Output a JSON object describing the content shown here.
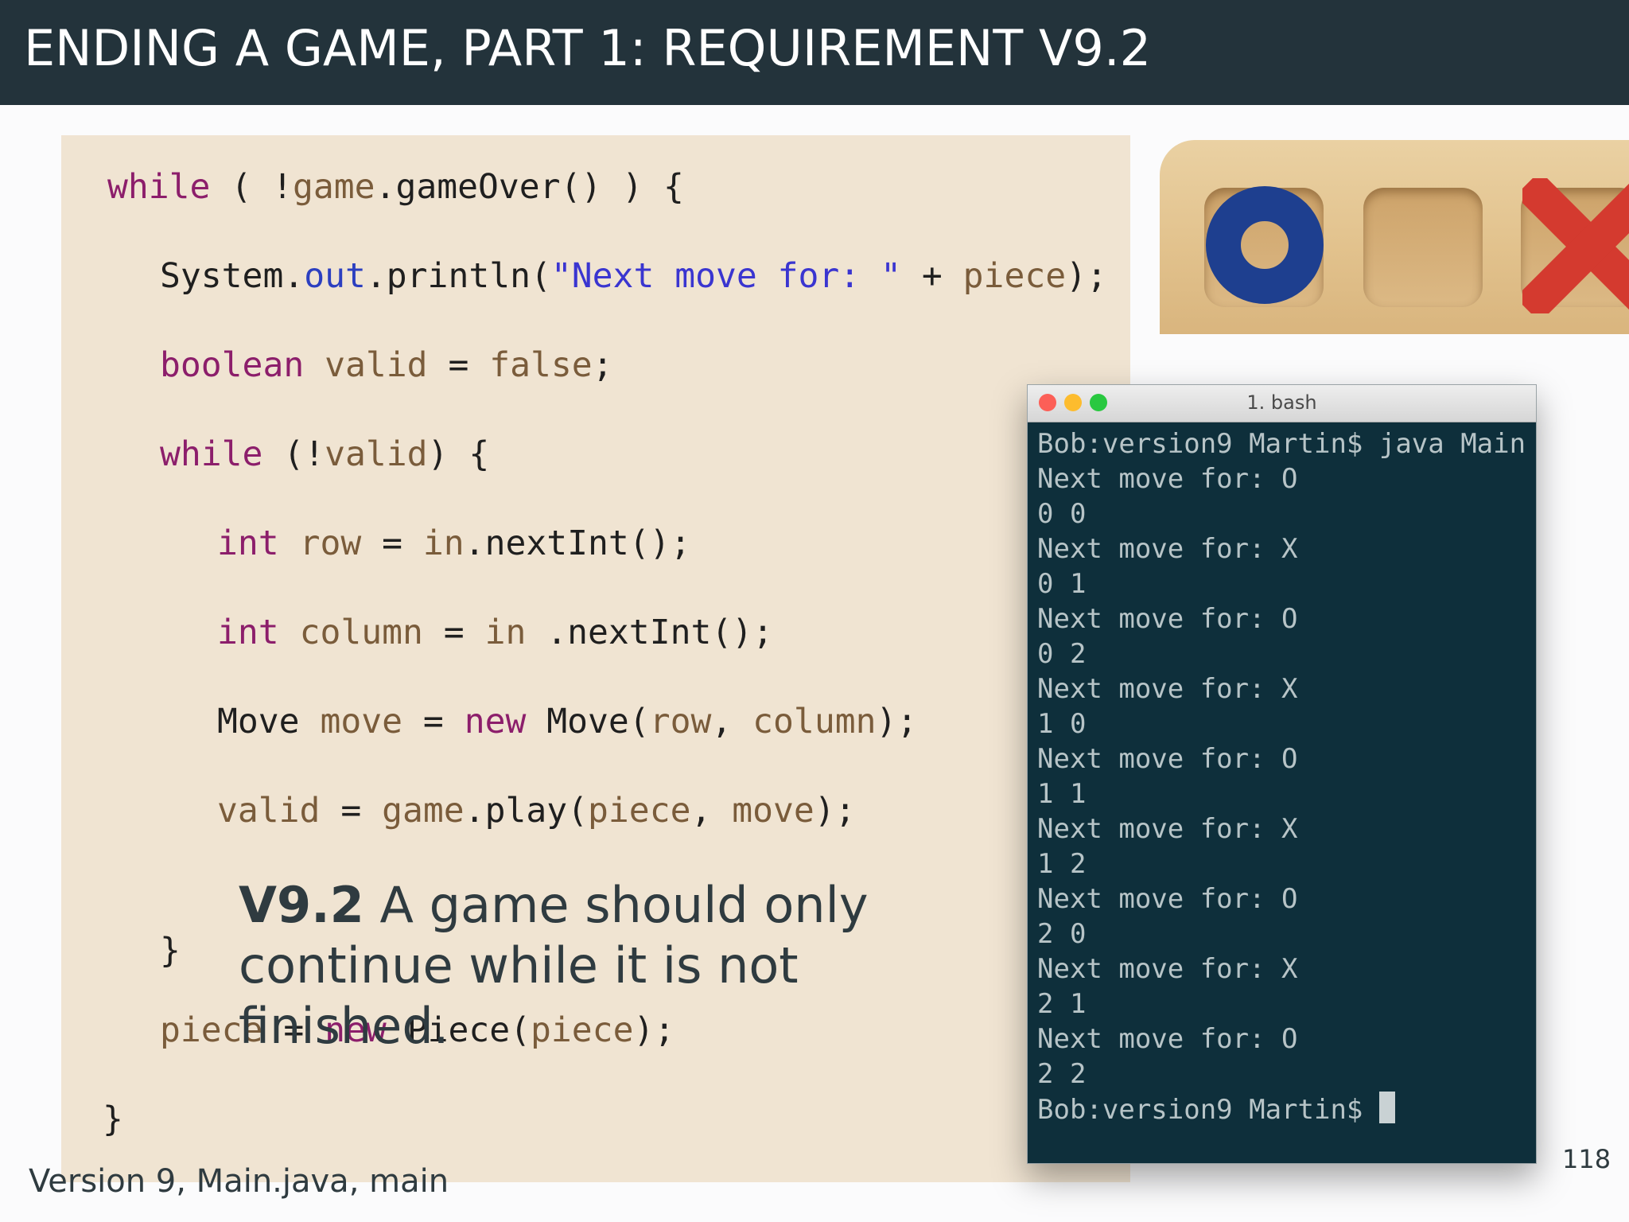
{
  "slide": {
    "title": "ENDING A GAME, PART 1: REQUIREMENT V9.2",
    "caption": "Version 9, Main.java, main",
    "page_number": "118"
  },
  "code": {
    "l1": {
      "a": "while",
      "b": " ( !",
      "c": "game",
      ".d": "",
      "d": ".gameOver() ) {"
    },
    "l2": {
      "a": "System.",
      "b": "out",
      "c": ".println(",
      "d": "\"Next move for: \"",
      "e": " + ",
      "f": "piece",
      "g": ");"
    },
    "l3": {
      "a": "boolean",
      "b": " ",
      "c": "valid",
      "d": " = ",
      "e": "false",
      "f": ";"
    },
    "l4": {
      "a": "while",
      "b": " (!",
      "c": "valid",
      "d": ") {"
    },
    "l5": {
      "a": "int",
      "b": " ",
      "c": "row",
      "d": " = ",
      "e": "in",
      "f": ".nextInt();"
    },
    "l6": {
      "a": "int",
      "b": " ",
      "c": "column",
      "d": " = ",
      "e": "in",
      "f": " .nextInt();"
    },
    "l7": {
      "a": "Move ",
      "b": "move",
      "c": " = ",
      "d": "new",
      "e": " Move(",
      "f": "row",
      "g": ", ",
      "h": "column",
      "i": ");"
    },
    "l8": {
      "a": "valid",
      "b": " = ",
      "c": "game",
      "d": ".play(",
      "e": "piece",
      "f": ", ",
      "g": "move",
      "h": ");"
    },
    "l9": {
      "a": "}"
    },
    "l10": {
      "a": "piece",
      "b": " = ",
      "c": "new",
      "d": " Piece(",
      "e": "piece",
      "f": ");"
    },
    "l11": {
      "a": "}"
    }
  },
  "note": {
    "label": "V9.2",
    "text_line1": " A game should only",
    "text_line2": "continue while it is not finished."
  },
  "terminal": {
    "title": "1. bash",
    "lines": [
      "Bob:version9 Martin$ java Main",
      "Next move for: O",
      "0 0",
      "Next move for: X",
      "0 1",
      "Next move for: O",
      "0 2",
      "Next move for: X",
      "1 0",
      "Next move for: O",
      "1 1",
      "Next move for: X",
      "1 2",
      "Next move for: O",
      "2 0",
      "Next move for: X",
      "2 1",
      "Next move for: O",
      "2 2"
    ],
    "prompt": "Bob:version9 Martin$ "
  },
  "colors": {
    "title_bar": "#23333b",
    "code_background": "#f0e4d2",
    "terminal_background": "#0e2f3b",
    "keyword": "#8c1e6b",
    "variable": "#7a5c3b",
    "string": "#3a35d0",
    "o_piece": "#1e3f8f",
    "x_piece": "#d43a2f"
  }
}
